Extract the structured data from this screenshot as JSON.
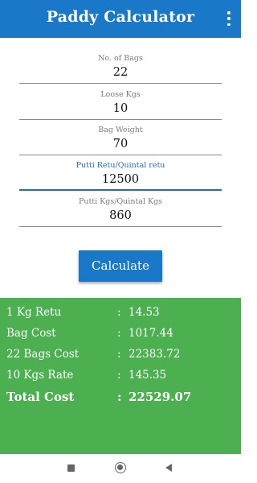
{
  "appbar": {
    "title": "Paddy Calculator",
    "menu_icon": "more-vert-icon",
    "color": "#1978c8"
  },
  "form": {
    "fields": [
      {
        "label": "No. of Bags",
        "value": "22"
      },
      {
        "label": "Loose Kgs",
        "value": "10"
      },
      {
        "label": "Bag Weight",
        "value": "70"
      },
      {
        "label": "Putti Retu/Quintal retu",
        "value": "12500",
        "focused": true
      },
      {
        "label": "Putti Kgs/Quintal Kgs",
        "value": "860"
      }
    ],
    "calculate_label": "Calculate"
  },
  "results": {
    "background": "#4caf50",
    "rows": [
      {
        "label": "1 Kg Retu",
        "sep": ":",
        "value": "14.53"
      },
      {
        "label": "Bag Cost",
        "sep": ":",
        "value": "1017.44"
      },
      {
        "label": "22 Bags Cost",
        "sep": ":",
        "value": "22383.72"
      },
      {
        "label": "10 Kgs Rate",
        "sep": ":",
        "value": "145.35"
      }
    ],
    "total": {
      "label": "Total Cost",
      "sep": ":",
      "value": "22529.07"
    }
  },
  "navbar": {
    "icons": [
      "recents-square-icon",
      "home-circle-icon",
      "back-triangle-icon"
    ]
  }
}
